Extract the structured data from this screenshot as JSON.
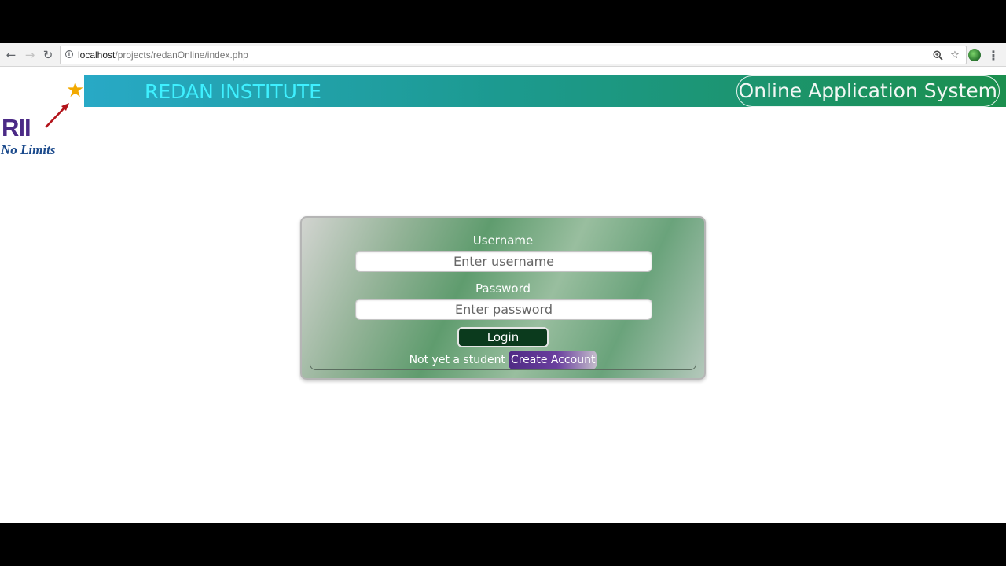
{
  "browser": {
    "url_host": "localhost",
    "url_path": "/projects/redanOnline/index.php",
    "back_icon": "back-arrow-icon",
    "forward_icon": "forward-arrow-icon",
    "reload_icon": "reload-icon",
    "info_icon": "info-icon",
    "zoom_icon": "zoom-icon",
    "bookmark_icon": "star-icon",
    "menu_icon": "menu-dots-icon"
  },
  "header": {
    "logo_text": "RII",
    "logo_tagline": "No Limits",
    "title": "REDAN INSTITUTE",
    "subtitle": "Online Application System"
  },
  "login": {
    "username_label": "Username",
    "username_placeholder": "Enter username",
    "password_label": "Password",
    "password_placeholder": "Enter password",
    "login_button": "Login",
    "signup_prompt": "Not yet a student",
    "create_account_button": "Create Account"
  },
  "colors": {
    "banner_start": "#28a9c6",
    "banner_end": "#1b8f4e",
    "title_text": "#3ff0ff",
    "login_button_bg": "#0b3a1d",
    "create_account_bg": "#4f2a85"
  }
}
